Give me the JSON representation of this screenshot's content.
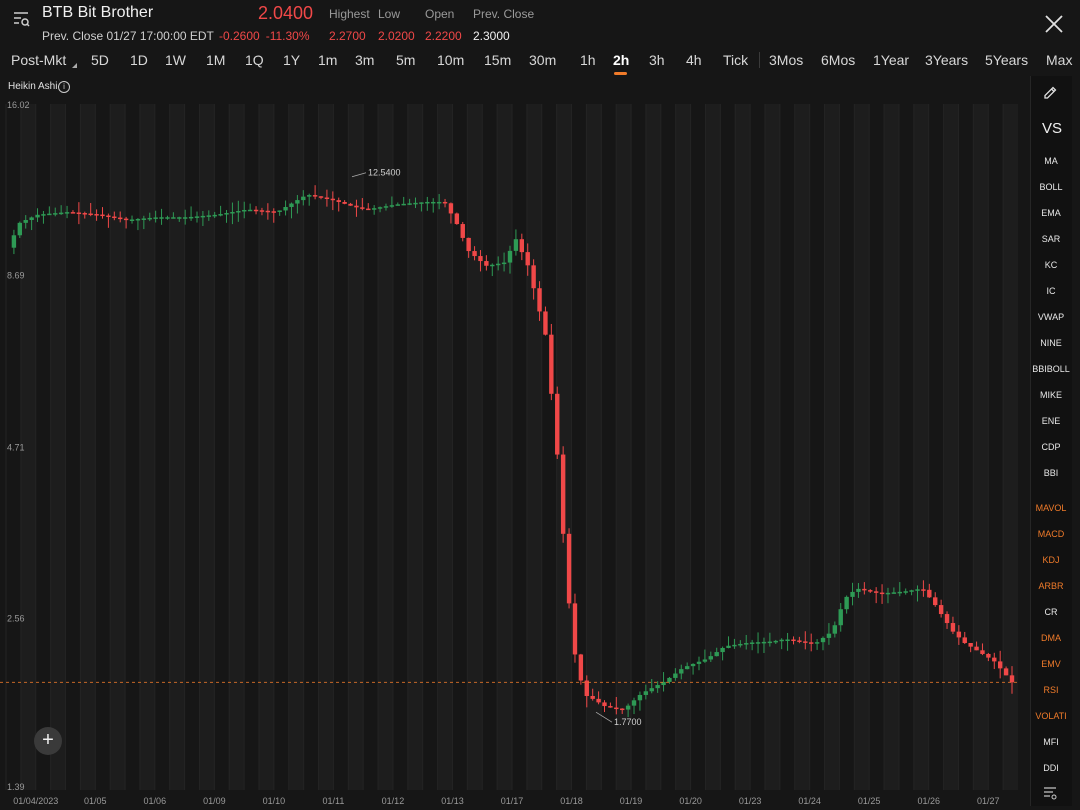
{
  "header": {
    "title": "BTB Bit Brother",
    "price": "2.0400",
    "prev_close_info": "Prev. Close 01/27 17:00:00 EDT",
    "change": "-0.2600",
    "change_pct": "-11.30%",
    "stats": [
      {
        "label": "Highest",
        "value": "2.2700"
      },
      {
        "label": "Low",
        "value": "2.0200"
      },
      {
        "label": "Open",
        "value": "2.2200"
      },
      {
        "label": "Prev. Close",
        "value": "2.3000"
      }
    ]
  },
  "tabs": [
    "Post-Mkt",
    "5D",
    "1D",
    "1W",
    "1M",
    "1Q",
    "1Y",
    "1m",
    "3m",
    "5m",
    "10m",
    "15m",
    "30m",
    "1h",
    "2h",
    "3h",
    "4h",
    "Tick",
    "3Mos",
    "6Mos",
    "1Year",
    "3Years",
    "5Years",
    "Max"
  ],
  "active_tab": "2h",
  "indicator_label": "Heikin Ashi",
  "sidebar": {
    "vs": "VS",
    "overlays": [
      "MA",
      "BOLL",
      "EMA",
      "SAR",
      "KC",
      "IC",
      "VWAP",
      "NINE",
      "BBIBOLL",
      "MIKE",
      "ENE",
      "CDP",
      "BBI"
    ],
    "indicators": [
      {
        "label": "MAVOL",
        "active": true
      },
      {
        "label": "MACD",
        "active": true
      },
      {
        "label": "KDJ",
        "active": true
      },
      {
        "label": "ARBR",
        "active": true
      },
      {
        "label": "CR",
        "active": false
      },
      {
        "label": "DMA",
        "active": true
      },
      {
        "label": "EMV",
        "active": true
      },
      {
        "label": "RSI",
        "active": true
      },
      {
        "label": "VOLATI",
        "active": true
      },
      {
        "label": "MFI",
        "active": false
      },
      {
        "label": "DDI",
        "active": false
      }
    ]
  },
  "colors": {
    "up": "#2e9a55",
    "down": "#f04848",
    "accent": "#f07b2a",
    "background": "#161616"
  },
  "chart_data": {
    "type": "candlestick",
    "style": "Heikin Ashi",
    "y_scale": "log",
    "ylim": [
      1.39,
      16.02
    ],
    "y_ticks": [
      "16.02",
      "8.69",
      "4.71",
      "2.56",
      "1.39"
    ],
    "x_ticks": [
      "01/04/2023",
      "01/05",
      "01/06",
      "01/09",
      "01/10",
      "01/11",
      "01/12",
      "01/13",
      "01/17",
      "01/18",
      "01/19",
      "01/20",
      "01/23",
      "01/24",
      "01/25",
      "01/26",
      "01/27"
    ],
    "annotations": [
      {
        "text": "12.5400",
        "value": 12.54
      },
      {
        "text": "1.7700",
        "value": 1.77
      }
    ],
    "current_price": 2.04,
    "path": [
      [
        0,
        9.6
      ],
      [
        0.2,
        10.5
      ],
      [
        0.5,
        10.8
      ],
      [
        1.0,
        10.9
      ],
      [
        1.5,
        10.8
      ],
      [
        2.0,
        10.6
      ],
      [
        2.5,
        10.7
      ],
      [
        3.0,
        10.7
      ],
      [
        3.5,
        10.8
      ],
      [
        4.0,
        11.0
      ],
      [
        4.5,
        10.9
      ],
      [
        5.0,
        11.6
      ],
      [
        5.4,
        11.4
      ],
      [
        5.8,
        11.1
      ],
      [
        6.0,
        11.0
      ],
      [
        6.5,
        11.2
      ],
      [
        7.0,
        11.3
      ],
      [
        7.3,
        11.3
      ],
      [
        7.5,
        10.5
      ],
      [
        7.7,
        9.5
      ],
      [
        8.0,
        9.0
      ],
      [
        8.3,
        9.1
      ],
      [
        8.5,
        9.9
      ],
      [
        8.7,
        9.0
      ],
      [
        9.0,
        7.0
      ],
      [
        9.1,
        5.6
      ],
      [
        9.2,
        4.5
      ],
      [
        9.35,
        2.9
      ],
      [
        9.5,
        2.2
      ],
      [
        9.65,
        1.95
      ],
      [
        9.8,
        1.92
      ],
      [
        10.0,
        1.87
      ],
      [
        10.3,
        1.85
      ],
      [
        10.6,
        1.96
      ],
      [
        11.0,
        2.05
      ],
      [
        11.3,
        2.15
      ],
      [
        11.7,
        2.22
      ],
      [
        12.0,
        2.32
      ],
      [
        12.4,
        2.35
      ],
      [
        12.8,
        2.36
      ],
      [
        13.0,
        2.38
      ],
      [
        13.5,
        2.34
      ],
      [
        13.8,
        2.45
      ],
      [
        14.0,
        2.75
      ],
      [
        14.2,
        2.85
      ],
      [
        14.6,
        2.8
      ],
      [
        15.0,
        2.82
      ],
      [
        15.3,
        2.85
      ],
      [
        15.5,
        2.7
      ],
      [
        15.8,
        2.45
      ],
      [
        16.0,
        2.35
      ],
      [
        16.5,
        2.2
      ],
      [
        16.8,
        2.04
      ]
    ]
  }
}
